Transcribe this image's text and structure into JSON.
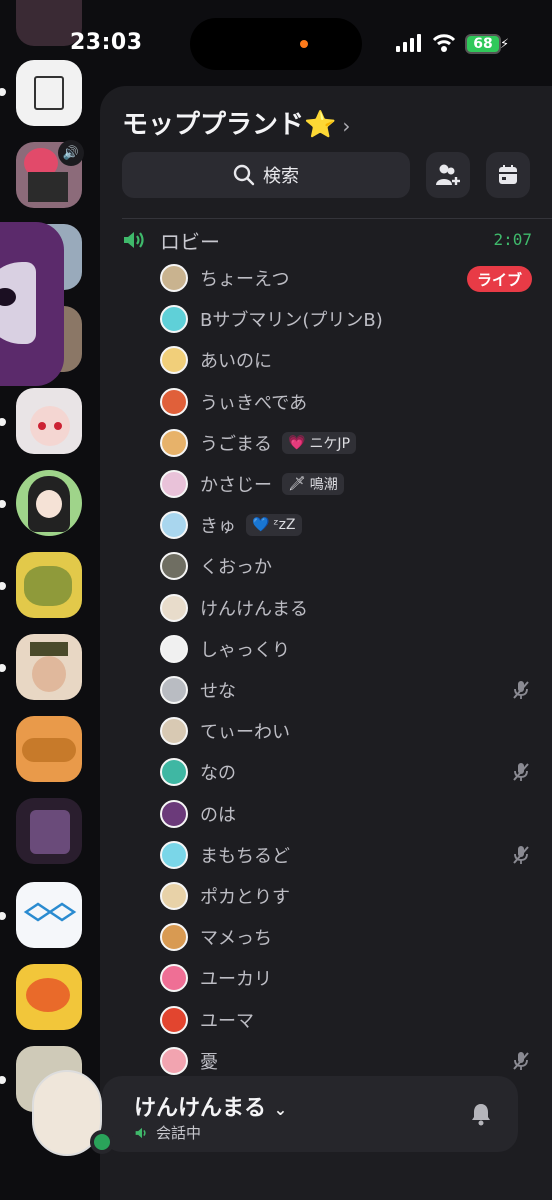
{
  "status_bar": {
    "time": "23:03",
    "battery": "68"
  },
  "server": {
    "name": "モッププランド⭐️",
    "chevron": "›"
  },
  "toolbar": {
    "search_label": "検索",
    "search_icon": "search-icon",
    "invite_icon": "add-member-icon",
    "events_icon": "calendar-icon"
  },
  "channel": {
    "name": "ロビー",
    "duration": "2:07"
  },
  "members": [
    {
      "name": "ちょーえつ",
      "live": "ライブ",
      "avatar_color": "#c9b38f"
    },
    {
      "name": "Bサブマリン(プリンB)",
      "avatar_color": "#5fd0d8"
    },
    {
      "name": "あいのに",
      "avatar_color": "#f1cf7a"
    },
    {
      "name": "うぃきぺであ",
      "avatar_color": "#e0603a"
    },
    {
      "name": "うごまる",
      "status_text": "ニケJP",
      "status_emoji": "💗",
      "avatar_color": "#e7b26a"
    },
    {
      "name": "かさじー",
      "status_text": "鳴潮",
      "status_emoji": "🗡",
      "avatar_color": "#e9c2d9"
    },
    {
      "name": "きゅ",
      "status_text": "ᶻzZ",
      "status_emoji": "💙",
      "avatar_color": "#a9d6ee"
    },
    {
      "name": "くおっか",
      "avatar_color": "#6f6e62"
    },
    {
      "name": "けんけんまる",
      "avatar_color": "#e8dccb"
    },
    {
      "name": "しゃっくり",
      "avatar_color": "#f0f0f0"
    },
    {
      "name": "せな",
      "muted": true,
      "avatar_color": "#b9bcc2"
    },
    {
      "name": "てぃーわい",
      "avatar_color": "#d8c9b3"
    },
    {
      "name": "なの",
      "muted": true,
      "avatar_color": "#3fb7a3"
    },
    {
      "name": "のは",
      "avatar_color": "#6b3a7a"
    },
    {
      "name": "まもちるど",
      "muted": true,
      "avatar_color": "#7ad6e8"
    },
    {
      "name": "ポカとりす",
      "avatar_color": "#e8d2a8"
    },
    {
      "name": "マメっち",
      "avatar_color": "#d89a52"
    },
    {
      "name": "ユーカリ",
      "avatar_color": "#ef6f95"
    },
    {
      "name": "ユーマ",
      "avatar_color": "#e2452f"
    },
    {
      "name": "憂",
      "muted": true,
      "avatar_color": "#f2a4b0"
    }
  ],
  "user": {
    "name": "けんけんまる",
    "status": "会話中",
    "dropdown": "⌄"
  },
  "colors": {
    "accent_green": "#3fb96b",
    "live_red": "#e83b46",
    "panel": "#1d1d21"
  }
}
